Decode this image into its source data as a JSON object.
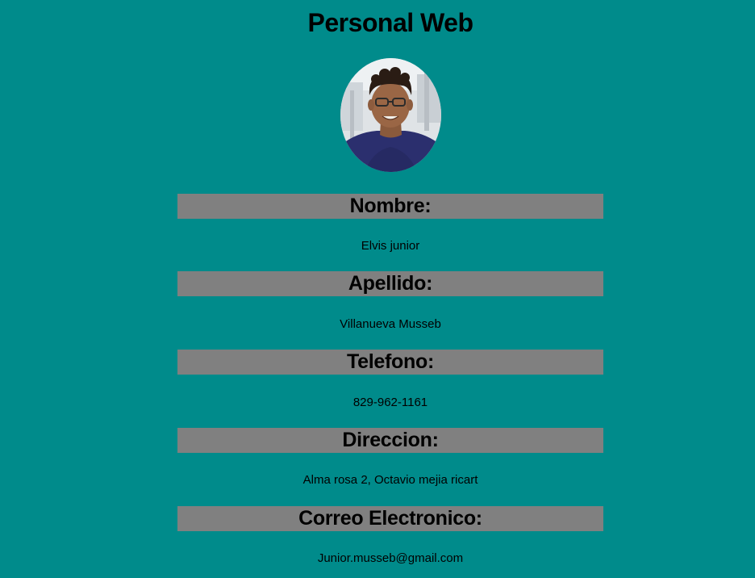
{
  "page": {
    "title": "Personal Web"
  },
  "profile": {
    "fields": [
      {
        "label": "Nombre:",
        "value": "Elvis junior"
      },
      {
        "label": "Apellido:",
        "value": "Villanueva Musseb"
      },
      {
        "label": "Telefono:",
        "value": "829-962-1161"
      },
      {
        "label": "Direccion:",
        "value": "Alma rosa 2, Octavio mejia ricart"
      },
      {
        "label": "Correo Electronico:",
        "value": "Junior.musseb@gmail.com"
      }
    ]
  },
  "colors": {
    "background": "#008b8b",
    "header_bar": "#808080",
    "text": "#000000"
  }
}
